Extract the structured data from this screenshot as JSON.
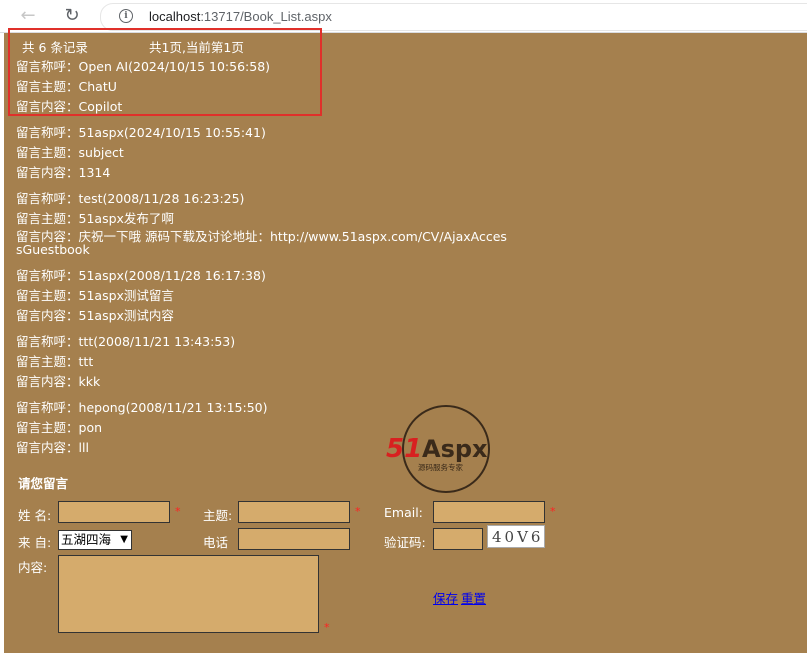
{
  "browser": {
    "url_host": "localhost",
    "url_rest": ":13717/Book_List.aspx"
  },
  "summary": {
    "count_text": "共 6 条记录",
    "page_text": "共1页,当前第1页"
  },
  "labels": {
    "name": "留言称呼：",
    "subject": "留言主题：",
    "content": "留言内容："
  },
  "messages": [
    {
      "name": "Open AI(2024/10/15 10:56:58)",
      "subject": "ChatU",
      "content": "Copilot"
    },
    {
      "name": "51aspx(2024/10/15 10:55:41)",
      "subject": "subject",
      "content": "1314"
    },
    {
      "name": "test(2008/11/28 16:23:25)",
      "subject": "51aspx发布了啊",
      "content": "庆祝一下哦 源码下载及讨论地址：http://www.51aspx.com/CV/AjaxAcces",
      "content_cont": "sGuestbook"
    },
    {
      "name": "51aspx(2008/11/28 16:17:38)",
      "subject": "51aspx测试留言",
      "content": "51aspx测试内容"
    },
    {
      "name": "ttt(2008/11/21 13:43:53)",
      "subject": "ttt",
      "content": "kkk"
    },
    {
      "name": "hepong(2008/11/21 13:15:50)",
      "subject": "pon",
      "content": "lll"
    }
  ],
  "watermark": {
    "brand_51": "51",
    "brand_aspx": "Aspx",
    "tagline": "源码服务专家"
  },
  "form": {
    "heading": "请您留言",
    "name_label": "姓 名:",
    "subject_label": "主题:",
    "email_label": "Email:",
    "from_label": "来 自:",
    "from_value": "五湖四海",
    "phone_label": "电话",
    "captcha_label": "验证码:",
    "content_label": "内容:",
    "captcha_text": "40V6",
    "required_mark": "*",
    "save_label": "保存",
    "reset_label": "重置"
  },
  "colors": {
    "page_bg": "#a5804e",
    "field_bg": "#d5ab6c",
    "highlight": "#e0302a"
  }
}
